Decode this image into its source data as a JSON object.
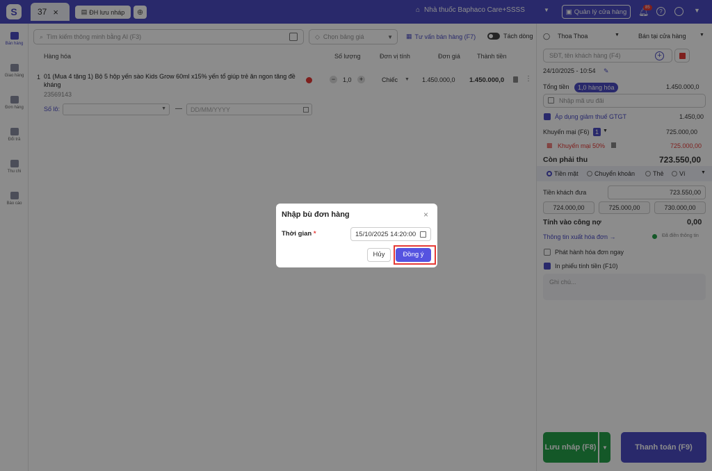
{
  "topbar": {
    "logo_letter": "S",
    "active_tab": "37",
    "draft_tab": "ĐH lưu nháp",
    "store_name": "Nhà thuốc Baphaco Care+SSSS",
    "manage_button": "Quản lý cửa hàng",
    "notif_count": "85"
  },
  "sidebar": {
    "items": [
      {
        "label": "Bán hàng"
      },
      {
        "label": "Giao hàng"
      },
      {
        "label": "Đơn hàng"
      },
      {
        "label": "Đổi trả"
      },
      {
        "label": "Thu chi"
      },
      {
        "label": "Báo cáo"
      }
    ]
  },
  "toolbar": {
    "search_placeholder": "Tìm kiếm thông minh bằng AI (F3)",
    "price_placeholder": "Chọn bảng giá",
    "consult_label": "Tư vấn bán hàng (F7)",
    "split_label": "Tách dòng"
  },
  "table": {
    "headers": [
      "Hàng hóa",
      "Số lượng",
      "Đơn vị tính",
      "Đơn giá",
      "Thành tiền"
    ],
    "row": {
      "index": "1",
      "name": "01 (Mua 4 tặng 1) Bộ 5 hộp yến sào Kids Grow 60ml x15% yến tổ giúp trẻ ăn ngon tăng đề kháng",
      "code": "23569143",
      "quantity": "1,0",
      "unit": "Chiếc",
      "price": "1.450.000,0",
      "total": "1.450.000,0",
      "lot_label": "Số lô:",
      "date_placeholder": "DD/MM/YYYY"
    }
  },
  "right_panel": {
    "staff": "Thoa Thoa",
    "sale_mode": "Bán tại cửa hàng",
    "customer_placeholder": "SĐT, tên khách hàng (F4)",
    "datetime": "24/10/2025 - 10:54",
    "total_label": "Tổng tiền",
    "total_badge": "1,0 hàng hóa",
    "total_value": "1.450.000,0",
    "promo_placeholder": "Nhập mã ưu đãi",
    "vat_label": "Áp dụng giảm thuế GTGT",
    "vat_value": "1.450,00",
    "discount_label": "Khuyến mại (F6)",
    "discount_count": "1",
    "discount_value": "725.000,00",
    "discount_item": "Khuyến mại 50%",
    "discount_item_value": "725.000,00",
    "remaining_label": "Còn phải thu",
    "remaining_value": "723.550,00",
    "pay_methods": [
      "Tiền mặt",
      "Chuyển khoản",
      "Thẻ",
      "Ví"
    ],
    "cash_label": "Tiền khách đưa",
    "cash_value": "723.550,00",
    "quick_amounts": [
      "724.000,00",
      "725.000,00",
      "730.000,00"
    ],
    "debt_label": "Tính vào công nợ",
    "debt_value": "0,00",
    "invoice_link": "Thông tin xuất hóa đơn →",
    "invoice_status": "Đã điền thông tin",
    "issue_invoice": "Phát hành hóa đơn ngay",
    "print_label": "In phiếu tính tiền (F10)",
    "note_placeholder": "Ghi chú...",
    "save_draft": "Lưu nháp (F8)",
    "pay_button": "Thanh toán (F9)"
  },
  "modal": {
    "title": "Nhập bù đơn hàng",
    "time_label": "Thời gian",
    "required_mark": "*",
    "time_value": "15/10/2025 14:20:00",
    "cancel": "Hủy",
    "confirm": "Đồng ý"
  },
  "colors": {
    "primary": "#4b4cc4",
    "success": "#26a14a",
    "danger": "#e53935"
  }
}
